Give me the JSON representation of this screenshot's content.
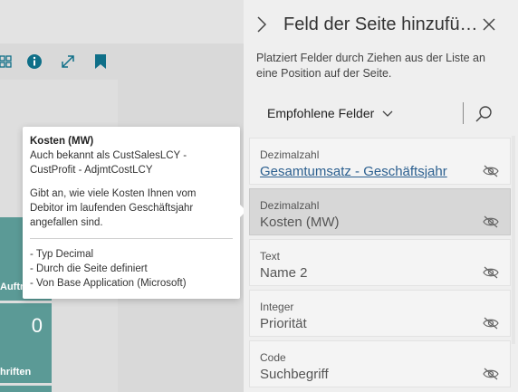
{
  "panel": {
    "title": "Feld der Seite hinzufü…",
    "description": "Platziert Felder durch Ziehen aus der Liste an eine Position auf der Seite.",
    "filter_label": "Empfohlene Felder",
    "fields": [
      {
        "type": "Dezimalzahl",
        "name": "Gesamtumsatz - Geschäftsjahr",
        "link": true
      },
      {
        "type": "Dezimalzahl",
        "name": "Kosten (MW)",
        "active": true
      },
      {
        "type": "Text",
        "name": "Name 2"
      },
      {
        "type": "Integer",
        "name": "Priorität"
      },
      {
        "type": "Code",
        "name": "Suchbegriff"
      }
    ]
  },
  "tooltip": {
    "title": "Kosten (MW)",
    "aka_line1": "Auch bekannt als CustSalesLCY -",
    "aka_line2": "CustProfit - AdjmtCostLCY",
    "desc_line1": "Gibt an, wie viele Kosten Ihnen vom",
    "desc_line2": "Debitor im laufenden Geschäftsjahr",
    "desc_line3": "angefallen sind.",
    "meta_line1": "- Typ Decimal",
    "meta_line2": "- Durch die Seite definiert",
    "meta_line3": "- Von Base Application (Microsoft)"
  },
  "background": {
    "tile1_label": "Auftr",
    "tile2_value": "0",
    "tile2_label": "hriften"
  },
  "colors": {
    "accent": "#0f6f88",
    "tile": "#5b9a96",
    "link": "#2b5f8f"
  },
  "icons": [
    "grid-icon",
    "info-icon",
    "expand-icon",
    "bookmark-icon",
    "chevron-right-icon",
    "close-icon",
    "chevron-down-icon",
    "search-icon",
    "eye-hidden-icon"
  ]
}
